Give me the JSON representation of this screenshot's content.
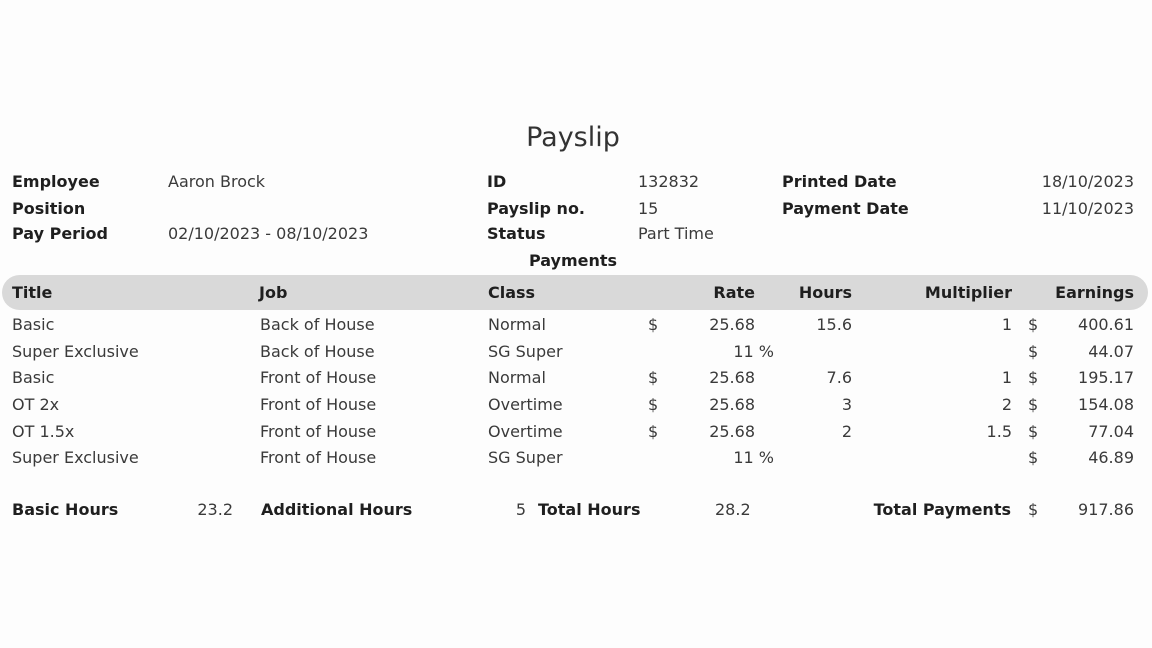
{
  "title": "Payslip",
  "info": {
    "employee_label": "Employee",
    "employee_value": "Aaron Brock",
    "position_label": "Position",
    "position_value": "",
    "pay_period_label": "Pay Period",
    "pay_period_value": "02/10/2023 - 08/10/2023",
    "id_label": "ID",
    "id_value": "132832",
    "payslip_no_label": "Payslip no.",
    "payslip_no_value": "15",
    "status_label": "Status",
    "status_value": "Part Time",
    "printed_date_label": "Printed Date",
    "printed_date_value": "18/10/2023",
    "payment_date_label": "Payment Date",
    "payment_date_value": "11/10/2023"
  },
  "payments_heading": "Payments",
  "table": {
    "headers": {
      "title": "Title",
      "job": "Job",
      "class": "Class",
      "rate": "Rate",
      "hours": "Hours",
      "multiplier": "Multiplier",
      "earnings": "Earnings"
    },
    "rows": [
      {
        "title": "Basic",
        "job": "Back of House",
        "class": "Normal",
        "rate_cur": "$",
        "rate": "25.68",
        "hours": "15.6",
        "multiplier": "1",
        "earn_cur": "$",
        "earnings": "400.61"
      },
      {
        "title": "Super Exclusive",
        "job": "Back of House",
        "class": "SG Super",
        "rate_cur": "",
        "rate": "11 %",
        "hours": "",
        "multiplier": "",
        "earn_cur": "$",
        "earnings": "44.07"
      },
      {
        "title": "Basic",
        "job": "Front of House",
        "class": "Normal",
        "rate_cur": "$",
        "rate": "25.68",
        "hours": "7.6",
        "multiplier": "1",
        "earn_cur": "$",
        "earnings": "195.17"
      },
      {
        "title": "OT 2x",
        "job": "Front of House",
        "class": "Overtime",
        "rate_cur": "$",
        "rate": "25.68",
        "hours": "3",
        "multiplier": "2",
        "earn_cur": "$",
        "earnings": "154.08"
      },
      {
        "title": "OT 1.5x",
        "job": "Front of House",
        "class": "Overtime",
        "rate_cur": "$",
        "rate": "25.68",
        "hours": "2",
        "multiplier": "1.5",
        "earn_cur": "$",
        "earnings": "77.04"
      },
      {
        "title": "Super Exclusive",
        "job": "Front of House",
        "class": "SG Super",
        "rate_cur": "",
        "rate": "11 %",
        "hours": "",
        "multiplier": "",
        "earn_cur": "$",
        "earnings": "46.89"
      }
    ]
  },
  "totals": {
    "basic_hours_label": "Basic Hours",
    "basic_hours_value": "23.2",
    "additional_hours_label": "Additional Hours",
    "additional_hours_value": "5",
    "total_hours_label": "Total Hours",
    "total_hours_value": "28.2",
    "total_payments_label": "Total Payments",
    "total_payments_currency": "$",
    "total_payments_value": "917.86"
  }
}
